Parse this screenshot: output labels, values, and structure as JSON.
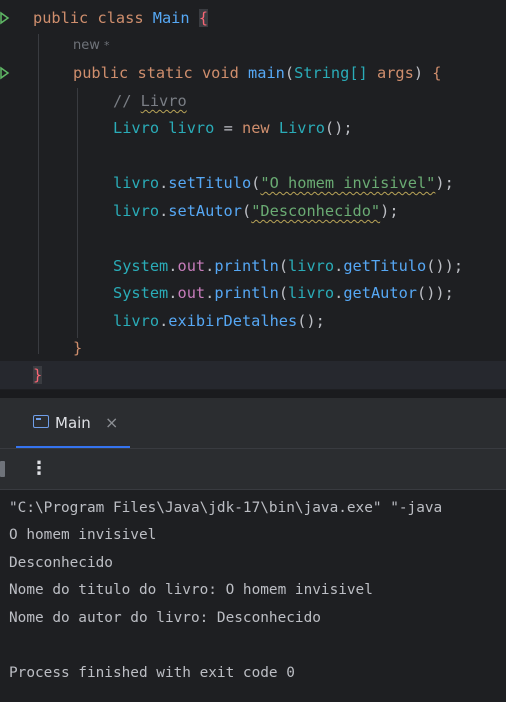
{
  "editor": {
    "line1": {
      "kw1": "public",
      "kw2": "class",
      "name": "Main",
      "brace": "{"
    },
    "hint": {
      "text": "new",
      "star": "*"
    },
    "line3": {
      "kw1": "public",
      "kw2": "static",
      "kw3": "void",
      "method": "main",
      "paren_open": "(",
      "type": "String[]",
      "param": "args",
      "paren_close": ")",
      "brace": "{"
    },
    "comment": {
      "slashes": "// ",
      "word": "Livro"
    },
    "line5": {
      "type": "Livro",
      "var": "livro",
      "assign": "=",
      "kw": "new",
      "ctor": "Livro",
      "end": "();"
    },
    "line7": {
      "obj": "livro",
      "dot": ".",
      "method": "setTitulo",
      "open": "(",
      "string": "\"O homem invisivel\"",
      "close": ");"
    },
    "line8": {
      "obj": "livro",
      "dot": ".",
      "method": "setAutor",
      "open": "(",
      "string": "\"Desconhecido\"",
      "close": ");"
    },
    "line10": {
      "cls": "System",
      "dot1": ".",
      "field": "out",
      "dot2": ".",
      "method": "println",
      "open": "(",
      "obj": "livro",
      "dot3": ".",
      "getter": "getTitulo",
      "close": "());"
    },
    "line11": {
      "cls": "System",
      "dot1": ".",
      "field": "out",
      "dot2": ".",
      "method": "println",
      "open": "(",
      "obj": "livro",
      "dot3": ".",
      "getter": "getAutor",
      "close": "());"
    },
    "line12": {
      "obj": "livro",
      "dot": ".",
      "method": "exibirDetalhes",
      "close": "();"
    },
    "line13": {
      "brace": "}"
    },
    "line14": {
      "brace": "}"
    }
  },
  "tool_window": {
    "tab_label": "Main",
    "tab_close": "×",
    "more_icon": "⋮"
  },
  "console": {
    "lines": [
      "\"C:\\Program Files\\Java\\jdk-17\\bin\\java.exe\" \"-java",
      "O homem invisivel",
      "Desconhecido",
      "Nome do titulo do livro: O homem invisivel",
      "Nome do autor do livro: Desconhecido",
      "",
      "Process finished with exit code 0"
    ]
  },
  "icons": {
    "run_gutter_1": "run-triangle-icon",
    "run_gutter_2": "run-triangle-icon",
    "tab_icon": "console-window-icon",
    "more_icon": "vertical-ellipsis-icon"
  },
  "colors": {
    "editor_bg": "#1e1f22",
    "keyword": "#cf8e6d",
    "method": "#56a8f5",
    "type": "#2aacb8",
    "string": "#6aab73",
    "field": "#c77dbb",
    "comment": "#7a7e85",
    "accent": "#3574f0",
    "error_brace": "#fa6675"
  }
}
